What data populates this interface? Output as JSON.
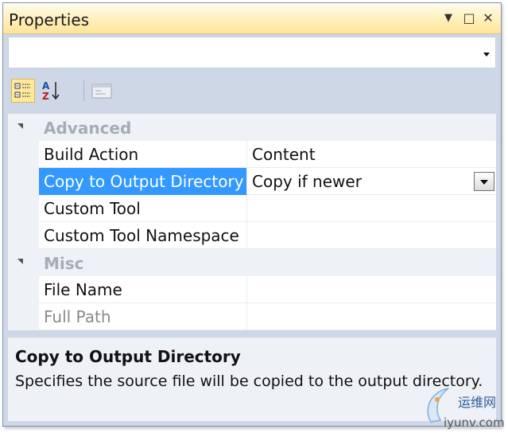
{
  "window": {
    "title": "Properties",
    "buttons": {
      "dropdown_glyph": "▼",
      "maximize_glyph": "□",
      "close_glyph": "✕"
    }
  },
  "object_selector": {
    "value": ""
  },
  "toolbar": {
    "items": [
      {
        "icon": "categorized-icon",
        "active": true
      },
      {
        "icon": "alphabetical-sort-icon",
        "active": false
      },
      {
        "icon": "property-pages-icon",
        "active": false
      }
    ]
  },
  "grid": {
    "categories": [
      {
        "label": "Advanced",
        "properties": [
          {
            "name": "Build Action",
            "value": "Content"
          },
          {
            "name": "Copy to Output Directory",
            "value": "Copy if newer"
          },
          {
            "name": "Custom Tool",
            "value": ""
          },
          {
            "name": "Custom Tool Namespace",
            "value": ""
          }
        ]
      },
      {
        "label": "Misc",
        "properties": [
          {
            "name": "File Name",
            "value": ""
          },
          {
            "name": "Full Path",
            "value": ""
          }
        ]
      }
    ]
  },
  "description": {
    "title": "Copy to Output Directory",
    "text": "Specifies the source file will be copied to the output directory."
  },
  "watermark": {
    "cn": "运维网",
    "url": "iyunv.com"
  },
  "colors": {
    "selection": "#3399ff",
    "title_gradient_top": "#fffcef",
    "title_gradient_bottom": "#ffe49a",
    "category_text": "#a6acb6"
  }
}
